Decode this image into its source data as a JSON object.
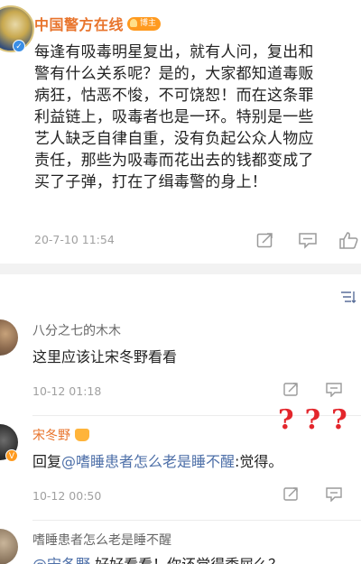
{
  "post": {
    "username": "中国警方在线",
    "badge": "博主",
    "lines": [
      "每逢有吸毒明星复出，就有人问，复出和",
      "警有什么关系呢？是的，大家都知道毒贩",
      "病狂，怙恶不悛，不可饶恕！而在这条罪",
      "利益链上，吸毒者也是一环。特别是一些",
      "艺人缺乏自律自重，没有负起公众人物应",
      "责任，那些为吸毒而花出去的钱都变成了",
      "买了子弹，打在了缉毒警的身上！"
    ],
    "timestamp": "20-7-10 11:54",
    "icons": [
      "share-icon",
      "comment-icon",
      "like-icon"
    ]
  },
  "sort_label": "",
  "comments": [
    {
      "username": "八分之七的木木",
      "text": "这里应该让宋冬野看看",
      "timestamp": "10-12 01:18"
    },
    {
      "username": "宋冬野",
      "reply_prefix": "回复",
      "mention": "@嗜睡患者怎么老是睡不醒",
      "reply_text": ":觉得。",
      "timestamp": "10-12 00:50"
    },
    {
      "username": "嗜睡患者怎么老是睡不醒",
      "mention": "@宋冬野",
      "reply_text": " 好好看看！你还觉得委屈么？"
    }
  ],
  "annotation": "? ? ?",
  "colors": {
    "username_orange": "#e8742c",
    "mention_blue": "#4d6fa8",
    "annotation_red": "#e3262c",
    "meta_gray": "#a0a0a0"
  }
}
